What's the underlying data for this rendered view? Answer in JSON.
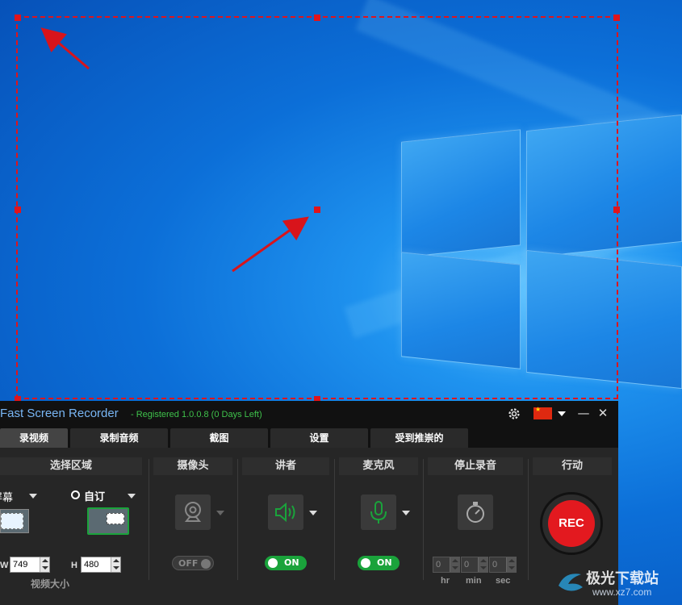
{
  "app": {
    "title": "Fast Screen Recorder",
    "registration": "- Registered 1.0.0.8 (0 Days Left)"
  },
  "tabs": [
    {
      "label": "录视频",
      "active": true
    },
    {
      "label": "录制音频",
      "active": false
    },
    {
      "label": "截图",
      "active": false
    },
    {
      "label": "设置",
      "active": false
    },
    {
      "label": "受到推崇的",
      "active": false
    }
  ],
  "sections": {
    "area": {
      "header": "选择区域",
      "fullscreen_label": "屏幕",
      "custom_label": "自订",
      "width_label": "W",
      "width_value": "749",
      "height_label": "H",
      "height_value": "480",
      "size_caption": "视频大小"
    },
    "webcam": {
      "header": "摄像头",
      "toggle_label": "OFF",
      "on": false
    },
    "speaker": {
      "header": "讲者",
      "toggle_label": "ON",
      "on": true
    },
    "mic": {
      "header": "麦克风",
      "toggle_label": "ON",
      "on": true
    },
    "stop": {
      "header": "停止录音",
      "hr_value": "0",
      "min_value": "0",
      "sec_value": "0",
      "hr_label": "hr",
      "min_label": "min",
      "sec_label": "sec"
    },
    "action": {
      "header": "行动",
      "rec_label": "REC"
    }
  },
  "titlebar": {
    "minimize": "—",
    "close": "✕"
  },
  "watermark": {
    "text": "极光下载站",
    "url": "www.xz7.com"
  },
  "colors": {
    "selection": "#e0141b",
    "title_blue": "#79b6f4",
    "registered_green": "#3fc24b",
    "toggle_on": "#1aa33b",
    "rec_red": "#e3191f"
  }
}
